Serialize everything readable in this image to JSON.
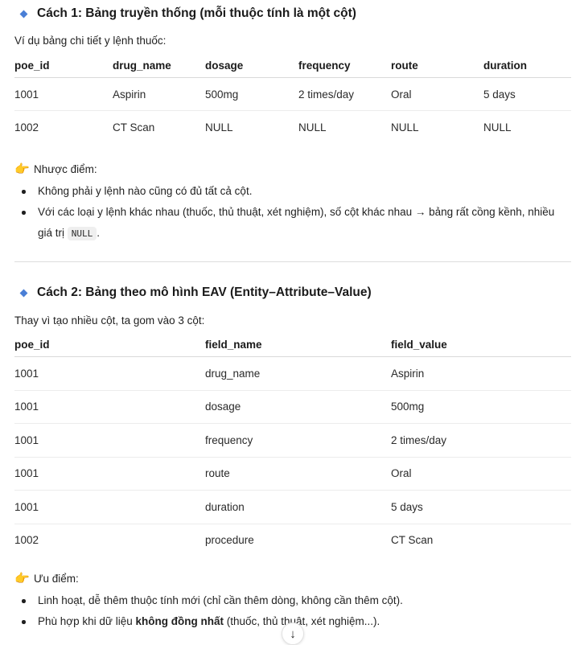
{
  "section1": {
    "heading": "Cách 1: Bảng truyền thống (mỗi thuộc tính là một cột)",
    "intro": "Ví dụ bảng chi tiết y lệnh thuốc:",
    "columns": [
      "poe_id",
      "drug_name",
      "dosage",
      "frequency",
      "route",
      "duration"
    ],
    "rows": [
      [
        "1001",
        "Aspirin",
        "500mg",
        "2 times/day",
        "Oral",
        "5 days"
      ],
      [
        "1002",
        "CT Scan",
        "NULL",
        "NULL",
        "NULL",
        "NULL"
      ]
    ],
    "note_label": "Nhược điểm:",
    "note_icon": "pointing-hand-icon",
    "bullets": {
      "b1": "Không phải y lệnh nào cũng có đủ tất cả cột.",
      "b2_text": "Với các loại y lệnh khác nhau (thuốc, thủ thuật, xét nghiệm), số cột khác nhau → bảng rất cồng kềnh, nhiều giá trị ",
      "b2_code": "NULL",
      "b2_end": "."
    }
  },
  "section2": {
    "heading": "Cách 2: Bảng theo mô hình EAV (Entity–Attribute–Value)",
    "intro": "Thay vì tạo nhiều cột, ta gom vào 3 cột:",
    "columns": [
      "poe_id",
      "field_name",
      "field_value"
    ],
    "rows": [
      [
        "1001",
        "drug_name",
        "Aspirin"
      ],
      [
        "1001",
        "dosage",
        "500mg"
      ],
      [
        "1001",
        "frequency",
        "2 times/day"
      ],
      [
        "1001",
        "route",
        "Oral"
      ],
      [
        "1001",
        "duration",
        "5 days"
      ],
      [
        "1002",
        "procedure",
        "CT Scan"
      ]
    ],
    "note_label": "Ưu điểm:",
    "note_icon": "pointing-hand-icon",
    "bullets": {
      "b1": "Linh hoạt, dễ thêm thuộc tính mới (chỉ cần thêm dòng, không cần thêm cột).",
      "b2_start": "Phù hợp khi dữ liệu ",
      "b2_bold": "không đồng nhất",
      "b2_end": " (thuốc, thủ thuật, xét nghiệm...)."
    }
  },
  "scroll_button": {
    "icon": "arrow-down-icon",
    "glyph": "↓"
  },
  "colors": {
    "diamond_accent": "#4a7fd6",
    "hand": "#f2a93b",
    "rule": "#dcdcdc"
  }
}
